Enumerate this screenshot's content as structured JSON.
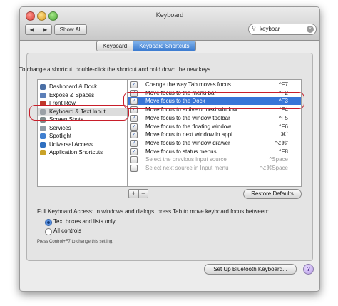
{
  "window": {
    "title": "Keyboard",
    "nav_back": "◀",
    "nav_forward": "▶",
    "show_all": "Show All",
    "search_value": "keyboar",
    "search_icon": "magnifier",
    "clear_icon": "×"
  },
  "tabs": [
    {
      "label": "Keyboard",
      "active": false
    },
    {
      "label": "Keyboard Shortcuts",
      "active": true
    }
  ],
  "instruction": "To change a shortcut, double-click the shortcut and hold down the new keys.",
  "categories": [
    {
      "label": "Dashboard & Dock",
      "icon_color": "#4a6fa5",
      "icon": "dashboard-icon"
    },
    {
      "label": "Exposé & Spaces",
      "icon_color": "#5c7fb8",
      "icon": "expose-icon"
    },
    {
      "label": "Front Row",
      "icon_color": "#c0392b",
      "icon": "front-row-icon"
    },
    {
      "label": "Keyboard & Text Input",
      "icon_color": "#9aa0a6",
      "icon": "keyboard-icon",
      "selected": true
    },
    {
      "label": "Screen Shots",
      "icon_color": "#7f8c8d",
      "icon": "screenshot-icon"
    },
    {
      "label": "Services",
      "icon_color": "#8e9aa5",
      "icon": "gear-icon"
    },
    {
      "label": "Spotlight",
      "icon_color": "#3f7fd0",
      "icon": "spotlight-icon"
    },
    {
      "label": "Universal Access",
      "icon_color": "#2f6fc0",
      "icon": "universal-access-icon"
    },
    {
      "label": "Application Shortcuts",
      "icon_color": "#c9a227",
      "icon": "app-shortcuts-icon"
    }
  ],
  "shortcuts": [
    {
      "label": "Change the way Tab moves focus",
      "key": "^F7",
      "checked": true
    },
    {
      "label": "Move focus to the menu bar",
      "key": "^F2",
      "checked": true
    },
    {
      "label": "Move focus to the Dock",
      "key": "^F3",
      "checked": true,
      "highlighted": true
    },
    {
      "label": "Move focus to active or next window",
      "key": "^F4",
      "checked": true
    },
    {
      "label": "Move focus to the window toolbar",
      "key": "^F5",
      "checked": true
    },
    {
      "label": "Move focus to the floating window",
      "key": "^F6",
      "checked": true
    },
    {
      "label": "Move focus to next window in appl...",
      "key": "⌘`",
      "checked": true
    },
    {
      "label": "Move focus to the window drawer",
      "key": "⌥⌘'",
      "checked": true
    },
    {
      "label": "Move focus to status menus",
      "key": "^F8",
      "checked": true
    },
    {
      "label": "Select the previous input source",
      "key": "^Space",
      "checked": false,
      "dim": true
    },
    {
      "label": "Select next source in Input menu",
      "key": "⌥⌘Space",
      "checked": false,
      "dim": true
    }
  ],
  "buttons": {
    "plus": "+",
    "minus": "−",
    "restore_defaults": "Restore Defaults",
    "bluetooth": "Set Up Bluetooth Keyboard...",
    "help": "?"
  },
  "full_keyboard_access": {
    "label": "Full Keyboard Access: In windows and dialogs, press Tab to move keyboard focus between:",
    "options": [
      {
        "label": "Text boxes and lists only",
        "selected": true
      },
      {
        "label": "All controls",
        "selected": false
      }
    ],
    "hint": "Press Control+F7 to change this setting."
  },
  "colors": {
    "highlight_ring": "#c81e2a",
    "selection_blue": "#3875d7"
  }
}
